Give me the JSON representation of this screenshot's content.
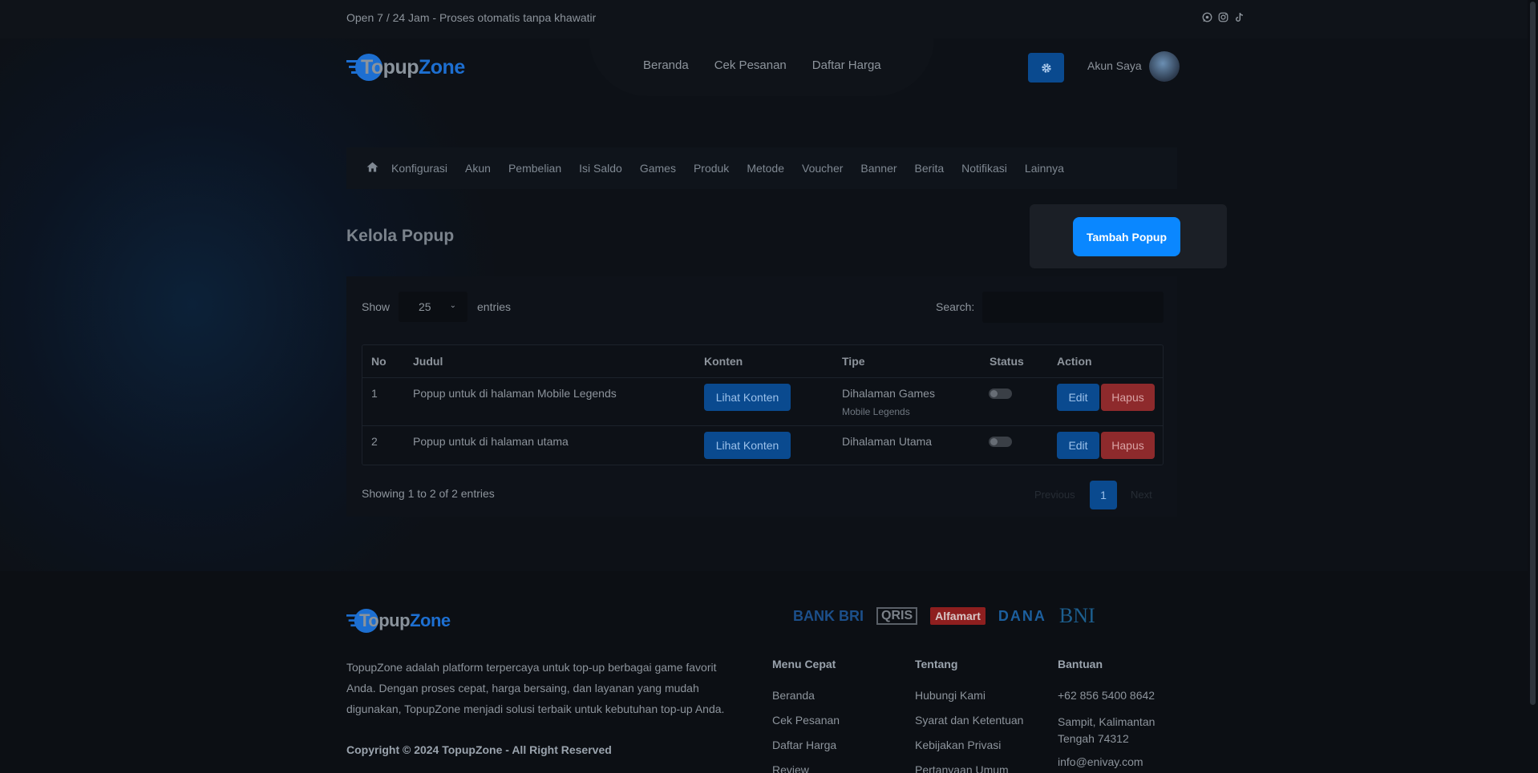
{
  "topbar": {
    "text": "Open 7 / 24 Jam - Proses otomatis tanpa khawatir",
    "social": [
      "whatsapp-icon",
      "instagram-icon",
      "tiktok-icon"
    ]
  },
  "brand": {
    "name_part1": "Topup",
    "name_part2": "Zone"
  },
  "nav": {
    "items": [
      "Beranda",
      "Cek Pesanan",
      "Daftar Harga"
    ]
  },
  "header": {
    "account_label": "Akun Saya"
  },
  "submenu": {
    "items": [
      "Konfigurasi",
      "Akun",
      "Pembelian",
      "Isi Saldo",
      "Games",
      "Produk",
      "Metode",
      "Voucher",
      "Banner",
      "Berita",
      "Notifikasi",
      "Lainnya"
    ]
  },
  "page": {
    "title": "Kelola Popup",
    "add_button": "Tambah Popup"
  },
  "datatable": {
    "show_label": "Show",
    "entries_value": "25",
    "entries_label": "entries",
    "search_label": "Search:",
    "search_value": "",
    "columns": [
      "No",
      "Judul",
      "Konten",
      "Tipe",
      "Status",
      "Action"
    ],
    "rows": [
      {
        "no": "1",
        "judul": "Popup untuk di halaman Mobile Legends",
        "konten_button": "Lihat Konten",
        "tipe": "Dihalaman Games",
        "tipe_sub": "Mobile Legends",
        "status_on": false,
        "edit": "Edit",
        "delete": "Hapus"
      },
      {
        "no": "2",
        "judul": "Popup untuk di halaman utama",
        "konten_button": "Lihat Konten",
        "tipe": "Dihalaman Utama",
        "tipe_sub": "",
        "status_on": false,
        "edit": "Edit",
        "delete": "Hapus"
      }
    ],
    "info": "Showing 1 to 2 of 2 entries",
    "pagination": {
      "previous": "Previous",
      "current": "1",
      "next": "Next"
    }
  },
  "footer": {
    "description": "TopupZone adalah platform terpercaya untuk top-up berbagai game favorit Anda. Dengan proses cepat, harga bersaing, dan layanan yang mudah digunakan, TopupZone menjadi solusi terbaik untuk kebutuhan top-up Anda.",
    "copyright": "Copyright © 2024 TopupZone - All Right Reserved",
    "payments": [
      "BANK BRI",
      "QRIS",
      "Alfamart",
      "DANA",
      "BNI"
    ],
    "columns": [
      {
        "title": "Menu Cepat",
        "links": [
          "Beranda",
          "Cek Pesanan",
          "Daftar Harga",
          "Review"
        ]
      },
      {
        "title": "Tentang",
        "links": [
          "Hubungi Kami",
          "Syarat dan Ketentuan",
          "Kebijakan Privasi",
          "Pertanyaan Umum"
        ]
      },
      {
        "title": "Bantuan",
        "links": [
          "+62 856 5400 8642",
          "Sampit, Kalimantan Tengah 74312",
          "info@enivay.com"
        ]
      }
    ]
  },
  "colors": {
    "accent": "#0a87ff",
    "primary_dark": "#0a4a8f",
    "danger": "#8e2a2c",
    "background": "#0d1117"
  }
}
